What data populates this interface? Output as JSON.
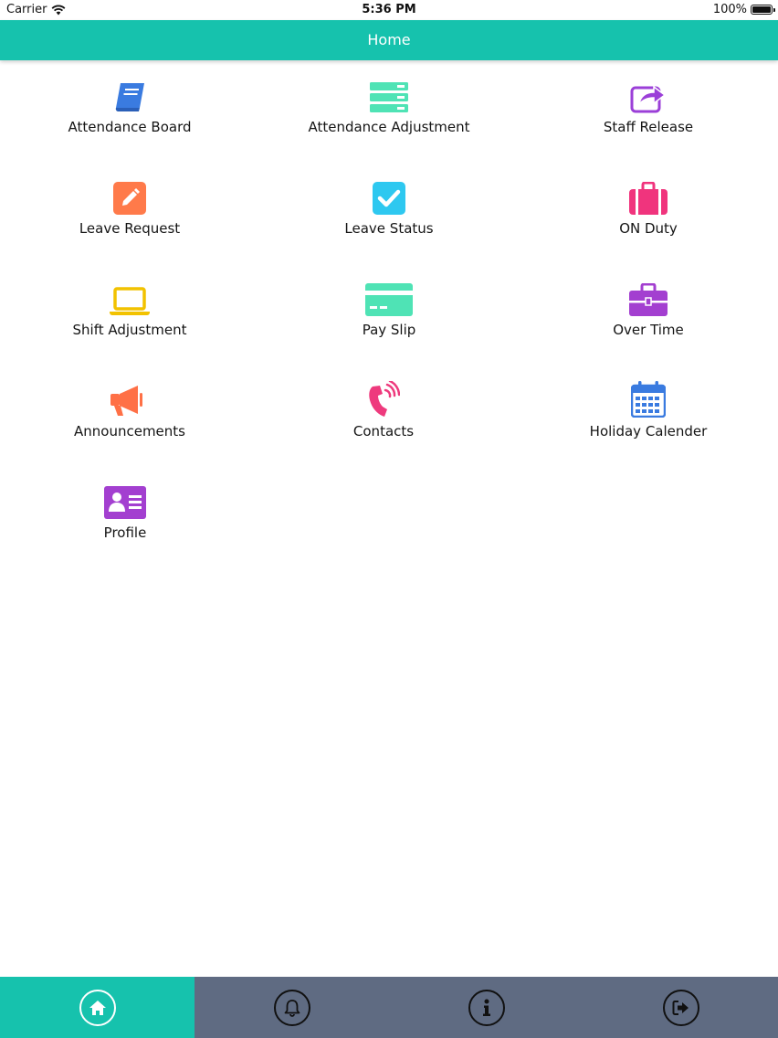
{
  "status_bar": {
    "carrier": "Carrier",
    "time": "5:36 PM",
    "battery": "100%"
  },
  "nav": {
    "title": "Home"
  },
  "menu": [
    {
      "label": "Attendance Board",
      "icon": "book-icon",
      "color": "#3a7be0"
    },
    {
      "label": "Attendance Adjustment",
      "icon": "server-stack-icon",
      "color": "#4fe3b5"
    },
    {
      "label": "Staff Release",
      "icon": "share-icon",
      "color": "#9b3fd8"
    },
    {
      "label": "Leave Request",
      "icon": "edit-icon",
      "color": "#ff7a4a"
    },
    {
      "label": "Leave Status",
      "icon": "checkbox-icon",
      "color": "#2ec8f0"
    },
    {
      "label": "ON Duty",
      "icon": "suitcase-icon",
      "color": "#f0347d"
    },
    {
      "label": "Shift Adjustment",
      "icon": "laptop-icon",
      "color": "#f2c200"
    },
    {
      "label": "Pay Slip",
      "icon": "credit-card-icon",
      "color": "#4fe3b5"
    },
    {
      "label": "Over Time",
      "icon": "briefcase-icon",
      "color": "#a33fd0"
    },
    {
      "label": "Announcements",
      "icon": "megaphone-icon",
      "color": "#ff7046"
    },
    {
      "label": "Contacts",
      "icon": "phone-icon",
      "color": "#ee3a7d"
    },
    {
      "label": "Holiday Calender",
      "icon": "calendar-icon",
      "color": "#3a7be0"
    },
    {
      "label": "Profile",
      "icon": "id-card-icon",
      "color": "#a33fd0"
    }
  ],
  "tabs": [
    {
      "name": "home",
      "icon": "home-icon",
      "active": true
    },
    {
      "name": "notifications",
      "icon": "bell-icon",
      "active": false
    },
    {
      "name": "info",
      "icon": "info-icon",
      "active": false
    },
    {
      "name": "logout",
      "icon": "logout-icon",
      "active": false
    }
  ],
  "colors": {
    "accent": "#16c2ad",
    "tabbar": "#5f6b82"
  }
}
